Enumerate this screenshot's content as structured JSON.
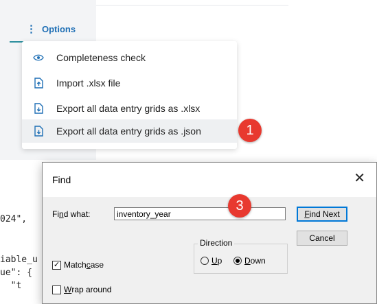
{
  "options": {
    "button_label": "Options",
    "button_icon": "vertical-dots-icon",
    "accent_color": "#1f6fb5",
    "items": [
      {
        "label": "Completeness check",
        "icon": "eye-icon"
      },
      {
        "label": "Import .xlsx file",
        "icon": "file-upload-icon"
      },
      {
        "label": "Export all data entry grids as .xlsx",
        "icon": "file-download-icon"
      },
      {
        "label": "Export all data entry grids as .json",
        "icon": "file-download-icon",
        "highlighted": true
      }
    ]
  },
  "annotations": {
    "step1": "1",
    "step3": "3",
    "color": "#e8392f"
  },
  "code_lines": [
    "024\",",
    "iable_u",
    "ue\": {",
    "  \"t"
  ],
  "find_dialog": {
    "title": "Find",
    "find_what_label_pre": "Fi",
    "find_what_label_ul": "n",
    "find_what_label_post": "d what:",
    "find_what_value": "inventory_year",
    "find_next_ul": "F",
    "find_next_rest": "ind Next",
    "cancel_label": "Cancel",
    "direction_label": "Direction",
    "up_ul": "U",
    "up_rest": "p",
    "down_ul": "D",
    "down_rest": "own",
    "direction_selected": "Down",
    "match_case_pre": "Match ",
    "match_case_ul": "c",
    "match_case_post": "ase",
    "match_case_checked": true,
    "wrap_ul": "W",
    "wrap_rest": "rap around",
    "wrap_checked": false
  }
}
